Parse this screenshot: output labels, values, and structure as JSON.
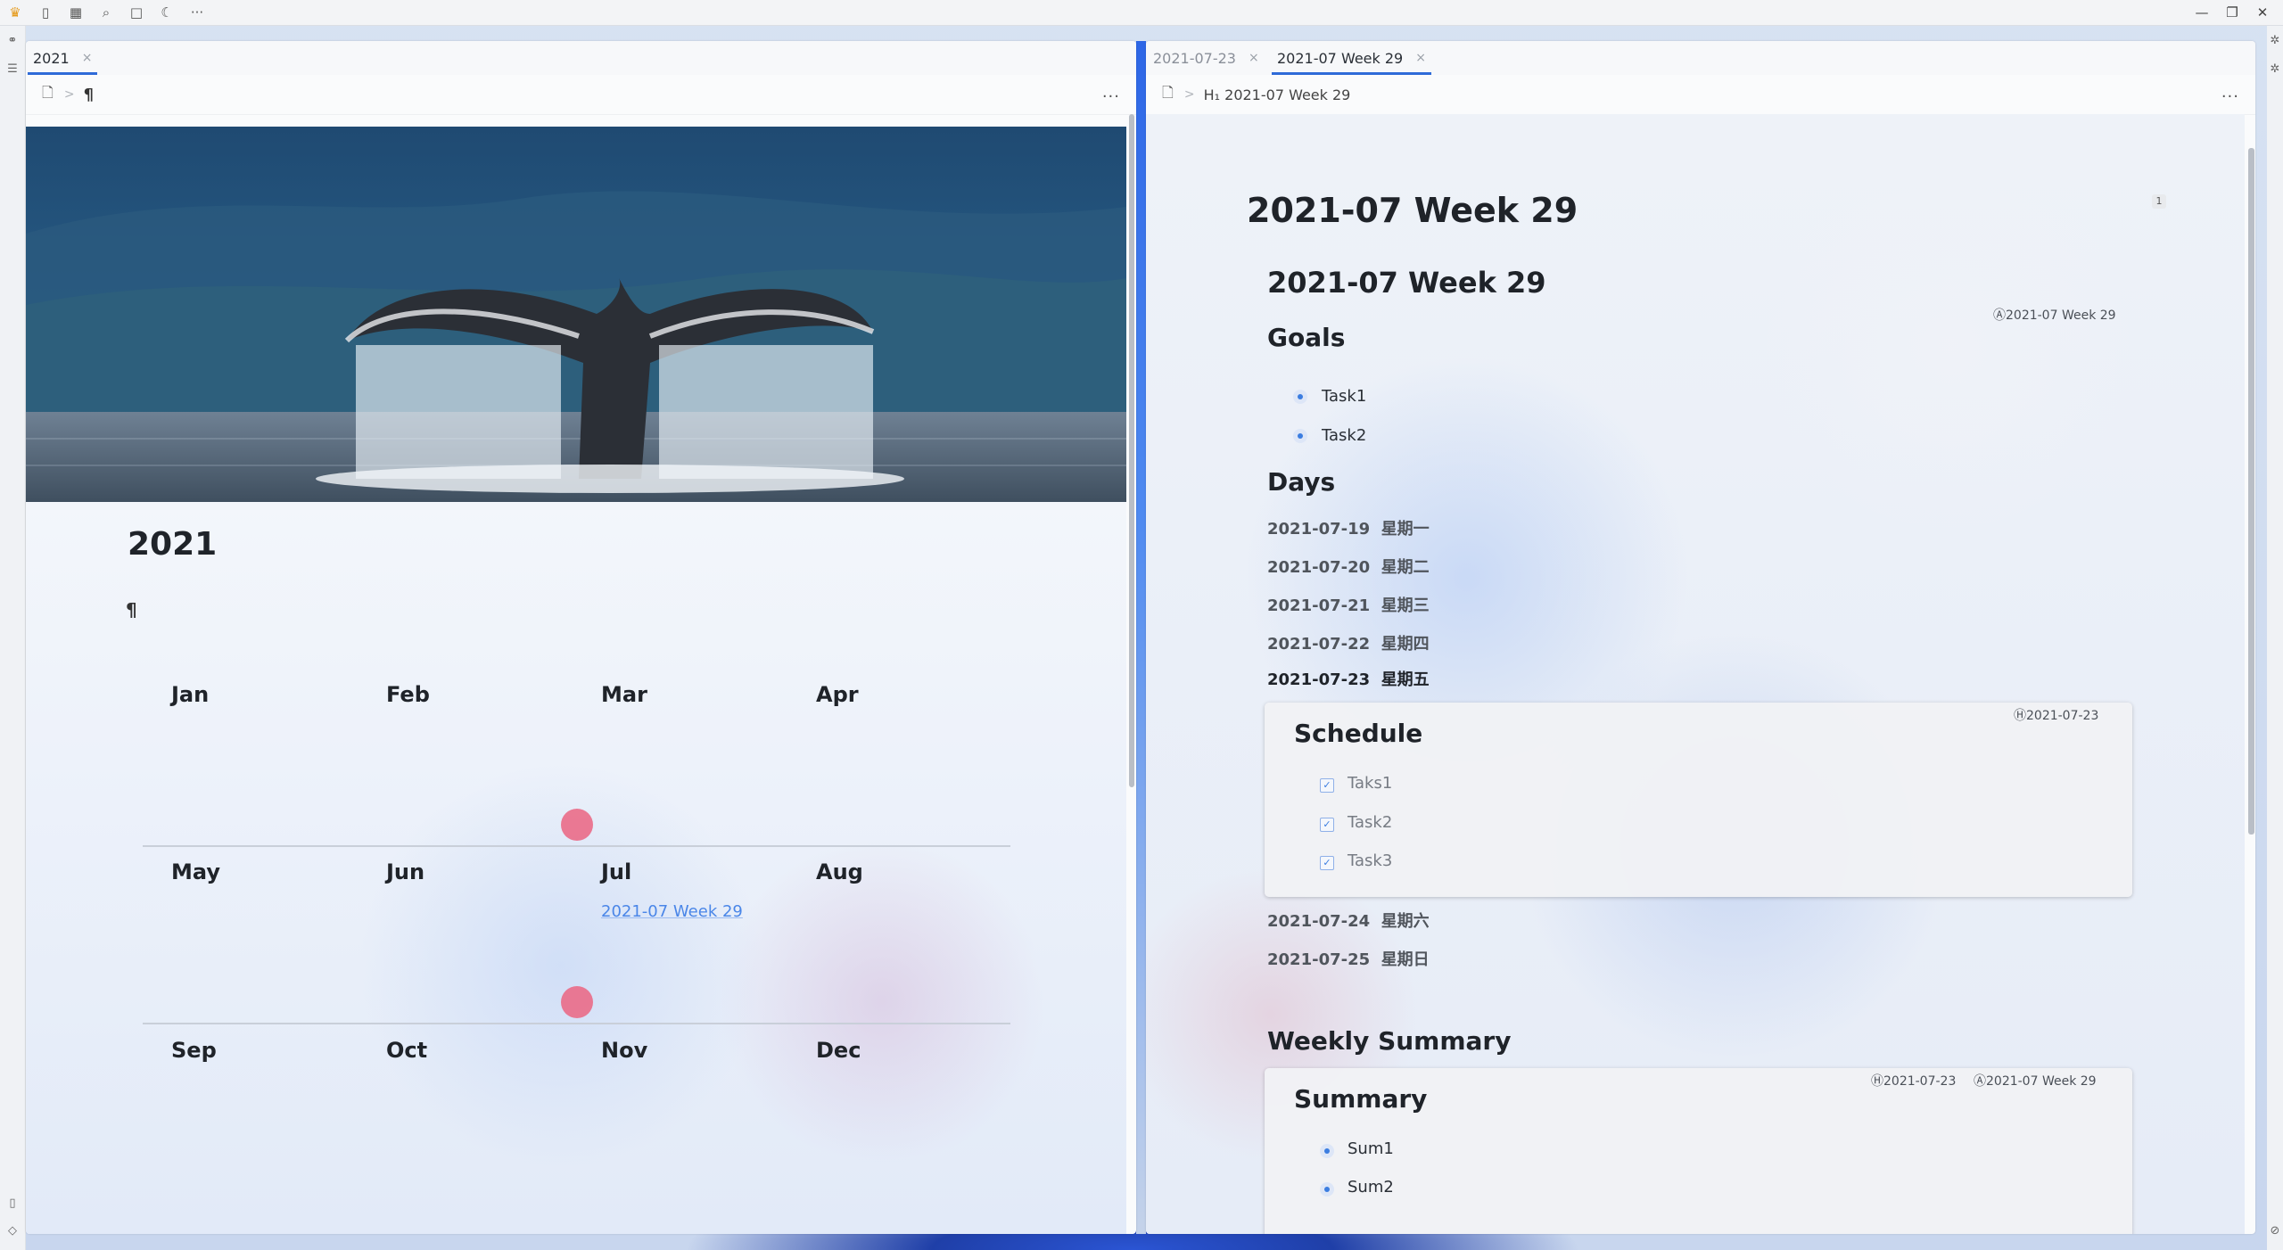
{
  "topbar": {
    "icons": [
      "crown-icon",
      "copy-icon",
      "calendar-icon",
      "search-icon",
      "square-icon",
      "moon-icon",
      "more-icon"
    ],
    "more": "···"
  },
  "left_pane": {
    "tabs": [
      {
        "label": "2021",
        "close": "×"
      }
    ],
    "breadcrumb": {
      "doc_icon": "document-icon",
      "separator": ">",
      "pilcrow": "¶"
    },
    "more": "···",
    "title": "2021",
    "pilcrow": "¶",
    "months": [
      "Jan",
      "Feb",
      "Mar",
      "Apr",
      "May",
      "Jun",
      "Jul",
      "Aug",
      "Sep",
      "Oct",
      "Nov",
      "Dec"
    ],
    "jul_link": "2021-07 Week 29"
  },
  "right_pane": {
    "tabs": [
      {
        "label": "2021-07-23",
        "close": "×"
      },
      {
        "label": "2021-07 Week 29",
        "close": "×"
      }
    ],
    "breadcrumb": {
      "doc_icon": "document-icon",
      "separator": ">",
      "heading": "H₁ 2021-07 Week 29"
    },
    "more": "···",
    "page_badge": "1",
    "title": "2021-07 Week 29",
    "subtitle": "2021-07 Week 29",
    "subtitle_ref": "Ⓐ2021-07 Week 29",
    "goals": {
      "heading": "Goals",
      "items": [
        "Task1",
        "Task2"
      ]
    },
    "days": {
      "heading": "Days",
      "items": [
        {
          "date": "2021-07-19",
          "weekday": "星期一"
        },
        {
          "date": "2021-07-20",
          "weekday": "星期二"
        },
        {
          "date": "2021-07-21",
          "weekday": "星期三"
        },
        {
          "date": "2021-07-22",
          "weekday": "星期四"
        },
        {
          "date": "2021-07-23",
          "weekday": "星期五"
        },
        {
          "date": "2021-07-24",
          "weekday": "星期六"
        },
        {
          "date": "2021-07-25",
          "weekday": "星期日"
        }
      ]
    },
    "schedule": {
      "heading": "Schedule",
      "ref": "Ⓗ2021-07-23",
      "items": [
        "Taks1",
        "Task2",
        "Task3"
      ],
      "check": "✓"
    },
    "weekly_summary": {
      "heading": "Weekly Summary",
      "card_heading": "Summary",
      "refs": [
        "Ⓗ2021-07-23",
        "Ⓐ2021-07 Week 29"
      ],
      "items": [
        "Sum1",
        "Sum2"
      ]
    }
  },
  "colors": {
    "accent": "#2f6bd8",
    "link": "#4a86e8",
    "dot": "#ea6c87",
    "bullet": "#3b7de0"
  }
}
